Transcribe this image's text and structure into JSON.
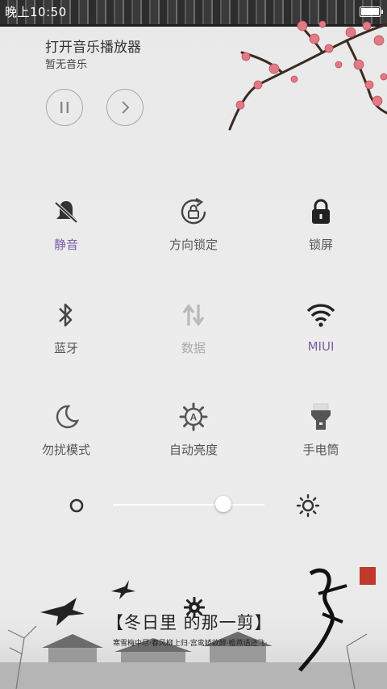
{
  "status": {
    "time": "晚上10:50",
    "battery_level": 1.0
  },
  "music": {
    "title": "打开音乐播放器",
    "subtitle": "暂无音乐",
    "pause_icon": "pause-icon",
    "next_icon": "chevron-right-icon"
  },
  "toggles": [
    {
      "label": "静音",
      "icon": "bell-muted-icon",
      "state": "active"
    },
    {
      "label": "方向锁定",
      "icon": "rotation-lock-icon",
      "state": "normal"
    },
    {
      "label": "锁屏",
      "icon": "lock-icon",
      "state": "normal"
    },
    {
      "label": "蓝牙",
      "icon": "bluetooth-icon",
      "state": "normal"
    },
    {
      "label": "数据",
      "icon": "data-arrows-icon",
      "state": "disabled"
    },
    {
      "label": "MIUI",
      "icon": "wifi-icon",
      "state": "active"
    },
    {
      "label": "勿扰模式",
      "icon": "moon-icon",
      "state": "normal"
    },
    {
      "label": "自动亮度",
      "icon": "auto-brightness-icon",
      "state": "normal"
    },
    {
      "label": "手电筒",
      "icon": "flashlight-icon",
      "state": "normal"
    }
  ],
  "brightness": {
    "level": 0.73
  },
  "theme": {
    "banner": "【冬日里 的那一剪】",
    "poem": "寒雪梅中尽·春风柳上归·宫鸾娇欲醉·檐燕语还飞·"
  },
  "colors": {
    "active": "#7a5fa5",
    "disabled": "#aaaaaa",
    "icon": "#333333"
  }
}
